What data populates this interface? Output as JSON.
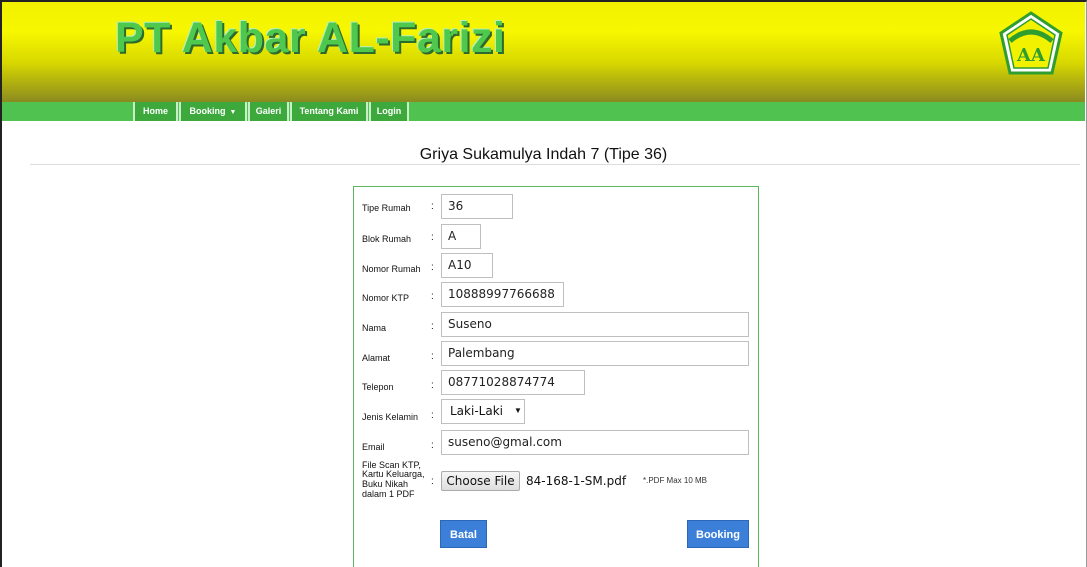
{
  "header": {
    "brand": "PT Akbar AL-Farizi"
  },
  "logo": {
    "icon": "company-logo-icon",
    "primary_color": "#2f9e2f",
    "accent_color": "#f2f200"
  },
  "nav": {
    "items": [
      {
        "label": "Home"
      },
      {
        "label": "Booking",
        "caret": "▼"
      },
      {
        "label": "Galeri"
      },
      {
        "label": "Tentang Kami"
      },
      {
        "label": "Login"
      }
    ]
  },
  "page": {
    "title": "Griya Sukamulya Indah 7 (Tipe 36)"
  },
  "form": {
    "separator": ":",
    "fields": [
      {
        "label": "Tipe Rumah",
        "value": "36"
      },
      {
        "label": "Blok Rumah",
        "value": "A"
      },
      {
        "label": "Nomor Rumah",
        "value": "A10"
      },
      {
        "label": "Nomor KTP",
        "value": "10888997766688"
      },
      {
        "label": "Nama",
        "value": "Suseno"
      },
      {
        "label": "Alamat",
        "value": "Palembang"
      },
      {
        "label": "Telepon",
        "value": "08771028874774"
      },
      {
        "label": "Jenis Kelamin",
        "value": "Laki-Laki"
      },
      {
        "label": "Email",
        "value": "suseno@gmal.com"
      }
    ],
    "file": {
      "label_lines": [
        "File Scan KTP,",
        "Kartu Keluarga,",
        "Buku Nikah",
        "dalam 1 PDF"
      ],
      "button_label": "Choose File",
      "file_name": "84-168-1-SM.pdf",
      "hint": "*.PDF Max 10 MB"
    },
    "buttons": {
      "cancel": "Batal",
      "submit": "Booking"
    }
  },
  "colors": {
    "nav_green": "#4fc24f",
    "button_blue": "#3b7fd8",
    "form_border": "#5cb85c"
  }
}
